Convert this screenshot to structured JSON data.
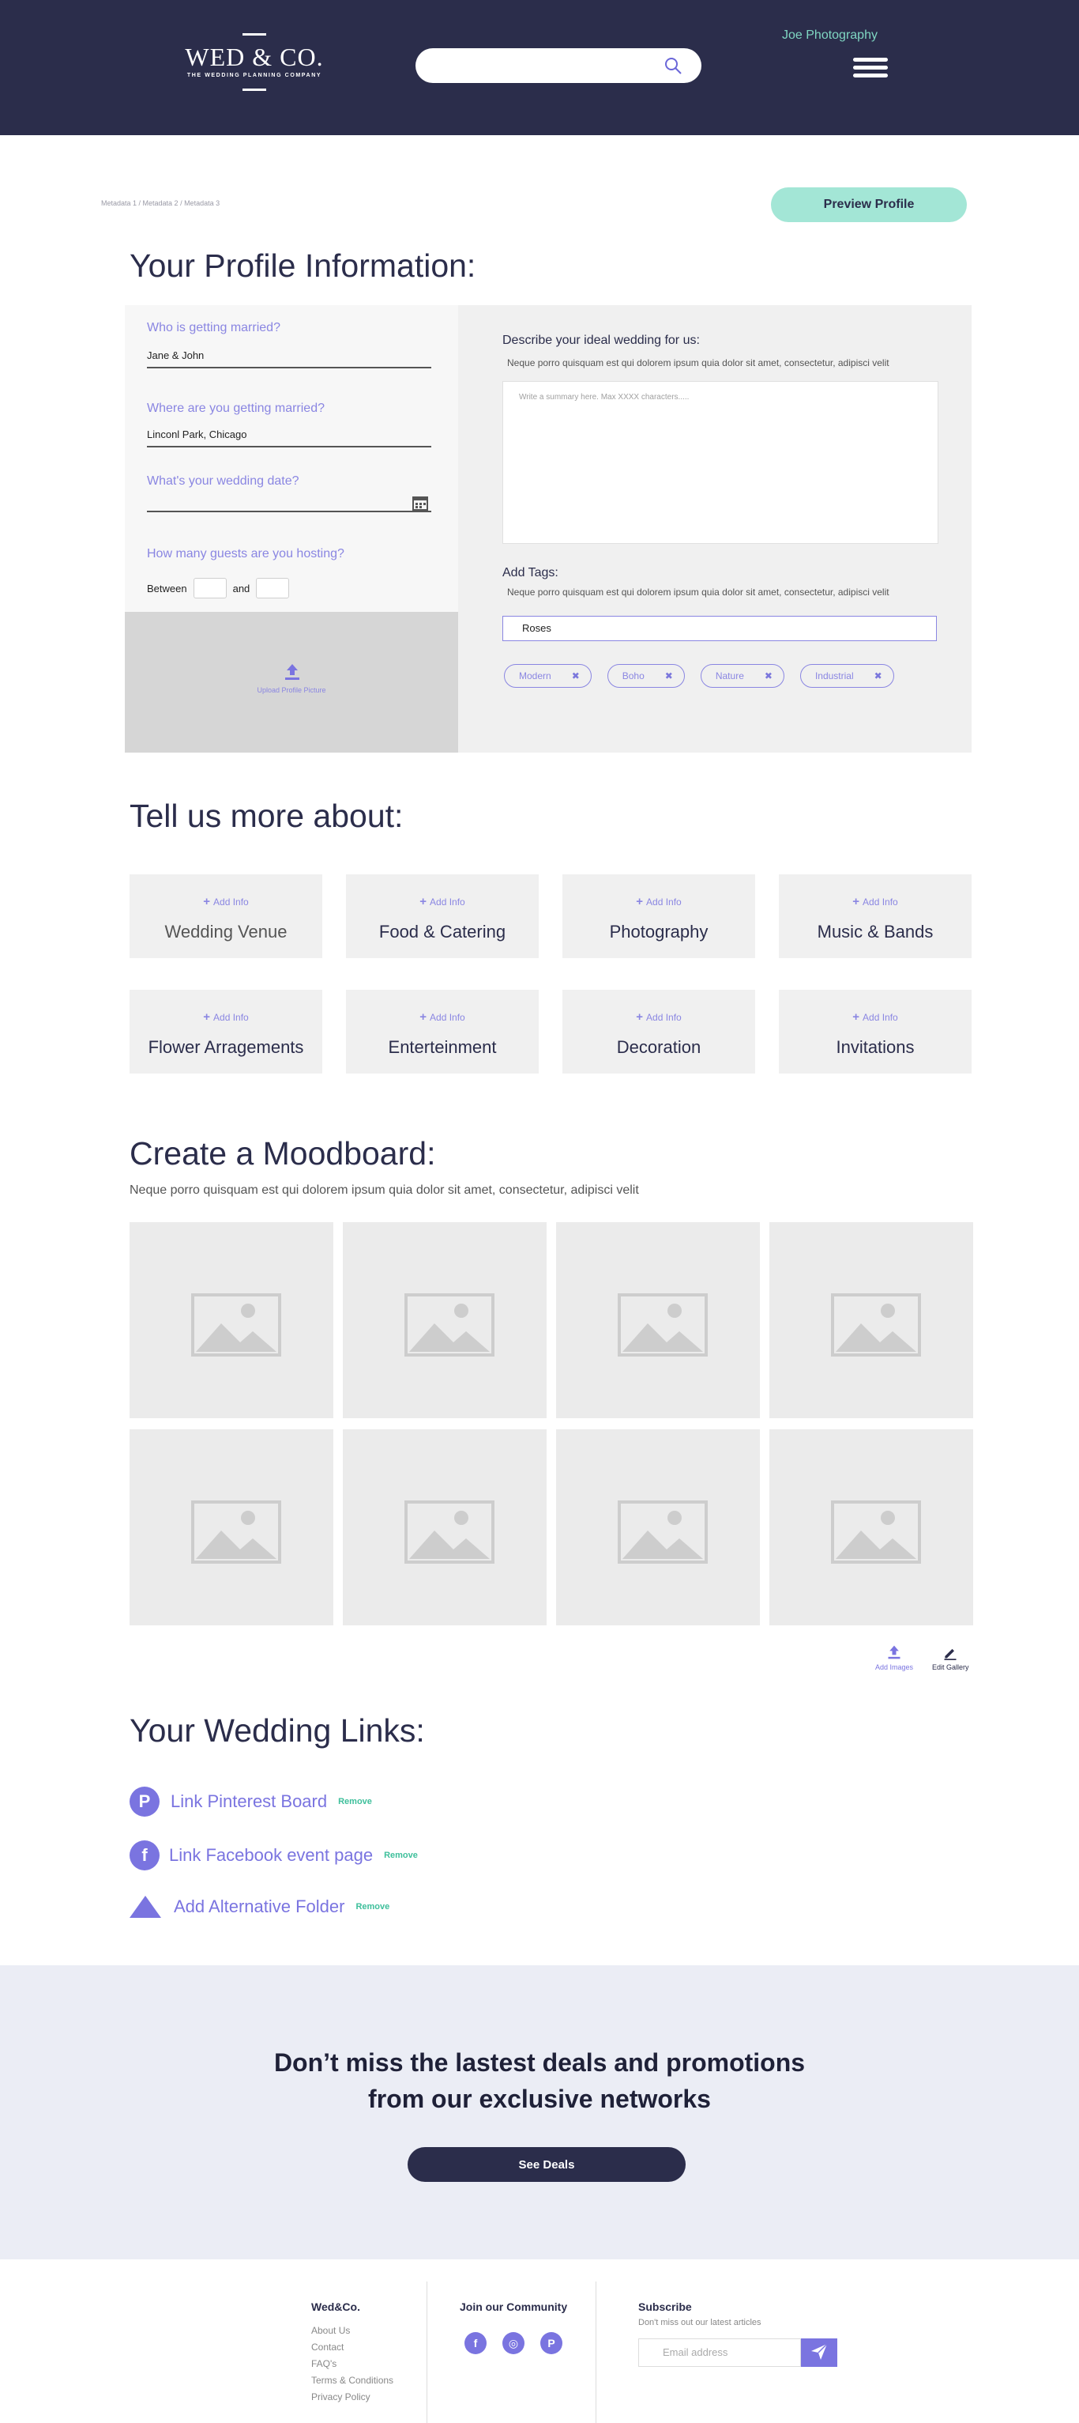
{
  "header": {
    "logo_name": "WED & CO.",
    "logo_tagline": "THE WEDDING PLANNING COMPANY",
    "search_placeholder": "",
    "user_link": "Joe Photography"
  },
  "breadcrumb": "Metadata 1 / Metadata 2 / Metadata 3",
  "preview_button": "Preview Profile",
  "profile": {
    "title": "Your Profile Information:",
    "who_label": "Who is getting married?",
    "who_value": "Jane & John",
    "where_label": "Where are you getting married?",
    "where_value": "Linconl Park, Chicago",
    "date_label": "What's your wedding date?",
    "date_value": "",
    "guests_label": "How many guests are you hosting?",
    "guests_between": "Between",
    "guests_and": "and",
    "upload_label": "Upload Profile Picture",
    "describe_title": "Describe your ideal wedding for us:",
    "describe_sub": "Neque porro quisquam est qui dolorem ipsum quia dolor sit amet, consectetur, adipisci velit",
    "summary_placeholder": "Write a summary here. Max XXXX characters.....",
    "tags_title": "Add Tags:",
    "tags_sub": "Neque porro quisquam est qui dolorem ipsum quia dolor sit amet, consectetur, adipisci velit",
    "tag_input_value": "Roses",
    "tags": [
      "Modern",
      "Boho",
      "Nature",
      "Industrial"
    ],
    "tag_remove_glyph": "✖"
  },
  "tell_us": {
    "title": "Tell us more about:",
    "add_label": "Add Info",
    "add_glyph": "+",
    "cards": [
      "Wedding Venue",
      "Food & Catering",
      "Photography",
      "Music & Bands",
      "Flower Arragements",
      "Enterteinment",
      "Decoration",
      "Invitations"
    ]
  },
  "moodboard": {
    "title": "Create a Moodboard:",
    "description": "Neque porro quisquam est qui dolorem ipsum quia dolor sit amet, consectetur, adipisci velit",
    "add_images": "Add Images",
    "edit_gallery": "Edit Gallery"
  },
  "links": {
    "title": "Your Wedding Links:",
    "items": [
      {
        "label": "Link Pinterest Board",
        "icon_glyph": "P",
        "remove": "Remove"
      },
      {
        "label": "Link Facebook event page",
        "icon_glyph": "f",
        "remove": "Remove"
      },
      {
        "label": "Add Alternative Folder",
        "remove": "Remove"
      }
    ]
  },
  "promo": {
    "line1": "Don’t miss the lastest deals and promotions",
    "line2": "from our exclusive networks",
    "button": "See Deals"
  },
  "footer": {
    "brand": "Wed&Co.",
    "links": [
      "About Us",
      "Contact",
      "FAQ's",
      "Terms & Conditions",
      "Privacy Policy"
    ],
    "community_title": "Join our Community",
    "social_glyphs": [
      "f",
      "◎",
      "P"
    ],
    "subscribe_title": "Subscribe",
    "subscribe_sub": "Don't miss out our latest articles",
    "email_placeholder": "Email address"
  },
  "colors": {
    "navy": "#2b2d4b",
    "accent_purple": "#7a74e0",
    "mint": "#a3e6d6",
    "remove_green": "#3ebf9b"
  }
}
